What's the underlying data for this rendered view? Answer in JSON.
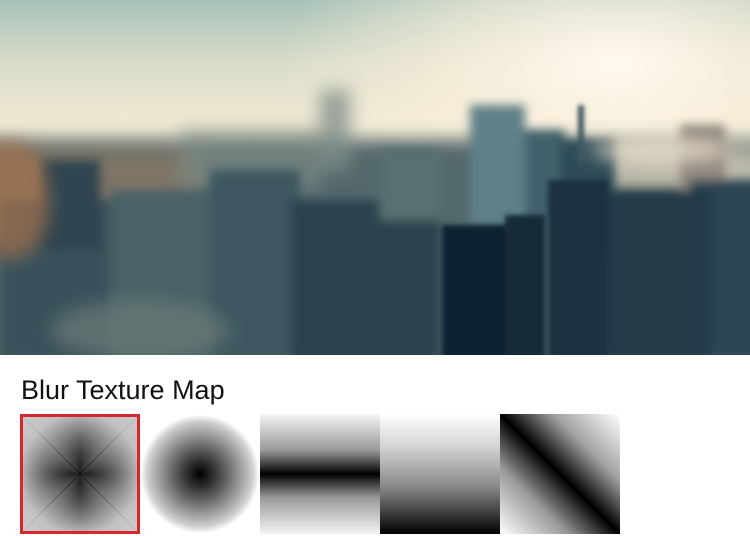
{
  "hero": {
    "image_subject": "blurred-city-skyline-photo",
    "colors": {
      "sky_top": "#a9c1b8",
      "sky_haze": "#f3ead4",
      "city_dark": "#1f3340",
      "city_mid": "#46636d",
      "city_warm": "#8a6a52"
    }
  },
  "blur_texture_map": {
    "title": "Blur Texture Map",
    "selected_index": 0,
    "selection_color": "#d7262f",
    "items": [
      {
        "icon": "square-gradient-map-icon"
      },
      {
        "icon": "radial-gradient-map-icon"
      },
      {
        "icon": "horizontal-band-map-icon"
      },
      {
        "icon": "vertical-gradient-map-icon"
      },
      {
        "icon": "diagonal-band-map-icon"
      }
    ]
  }
}
